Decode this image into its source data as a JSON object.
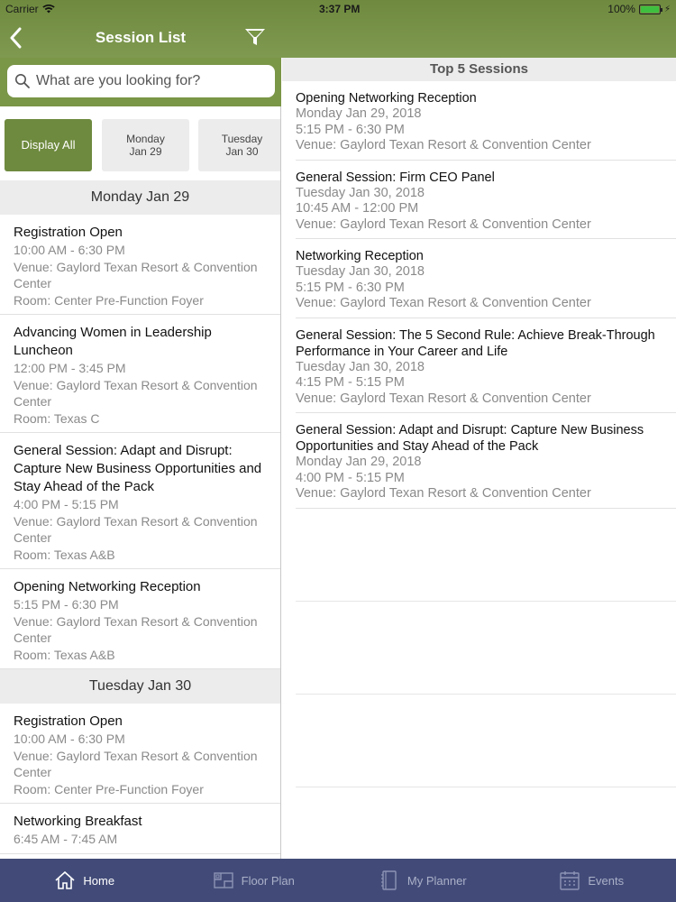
{
  "status": {
    "carrier": "Carrier",
    "time": "3:37 PM",
    "battery": "100%",
    "battery_level": 1.0
  },
  "nav": {
    "title": "Session List"
  },
  "search": {
    "placeholder": "What are you looking for?"
  },
  "filters": [
    {
      "line1": "Display All",
      "line2": ""
    },
    {
      "line1": "Monday",
      "line2": "Jan 29"
    },
    {
      "line1": "Tuesday",
      "line2": "Jan 30"
    }
  ],
  "days": [
    {
      "header": "Monday Jan 29",
      "sessions": [
        {
          "title": "Registration Open",
          "time": "10:00 AM - 6:30 PM",
          "venue": "Venue: Gaylord Texan Resort & Convention Center",
          "room": "Room: Center Pre-Function Foyer"
        },
        {
          "title": "Advancing Women in Leadership Luncheon",
          "time": "12:00 PM - 3:45 PM",
          "venue": "Venue: Gaylord Texan Resort & Convention Center",
          "room": "Room: Texas C"
        },
        {
          "title": "General Session: Adapt and Disrupt: Capture New Business Opportunities and Stay Ahead of the Pack",
          "time": "4:00 PM - 5:15 PM",
          "venue": "Venue: Gaylord Texan Resort & Convention Center",
          "room": "Room: Texas A&B"
        },
        {
          "title": "Opening Networking Reception",
          "time": "5:15 PM - 6:30 PM",
          "venue": "Venue: Gaylord Texan Resort & Convention Center",
          "room": "Room: Texas A&B"
        }
      ]
    },
    {
      "header": "Tuesday Jan 30",
      "sessions": [
        {
          "title": "Registration Open",
          "time": "10:00 AM - 6:30 PM",
          "venue": "Venue: Gaylord Texan Resort & Convention Center",
          "room": "Room: Center Pre-Function Foyer"
        },
        {
          "title": "Networking Breakfast",
          "time": "6:45 AM - 7:45 AM",
          "venue": "",
          "room": ""
        }
      ]
    }
  ],
  "top5": {
    "header": "Top 5 Sessions",
    "items": [
      {
        "title": "Opening Networking Reception",
        "date": "Monday Jan 29, 2018",
        "time": "5:15 PM - 6:30 PM",
        "venue": "Venue: Gaylord Texan Resort & Convention Center"
      },
      {
        "title": "General Session: Firm CEO Panel",
        "date": "Tuesday Jan 30, 2018",
        "time": "10:45 AM - 12:00 PM",
        "venue": "Venue: Gaylord Texan Resort & Convention Center"
      },
      {
        "title": "Networking Reception",
        "date": "Tuesday Jan 30, 2018",
        "time": "5:15 PM - 6:30 PM",
        "venue": "Venue: Gaylord Texan Resort & Convention Center"
      },
      {
        "title": "General Session: The 5 Second Rule: Achieve Break-Through Performance in Your Career and Life",
        "date": "Tuesday Jan 30, 2018",
        "time": "4:15 PM - 5:15 PM",
        "venue": "Venue: Gaylord Texan Resort & Convention Center"
      },
      {
        "title": "General Session: Adapt and Disrupt: Capture New Business Opportunities and Stay Ahead of the Pack",
        "date": "Monday Jan 29, 2018",
        "time": "4:00 PM - 5:15 PM",
        "venue": "Venue: Gaylord Texan Resort & Convention Center"
      }
    ]
  },
  "tabs": [
    {
      "label": "Home",
      "icon": "home-icon"
    },
    {
      "label": "Floor Plan",
      "icon": "floor-plan-icon"
    },
    {
      "label": "My Planner",
      "icon": "planner-icon"
    },
    {
      "label": "Events",
      "icon": "calendar-icon"
    }
  ],
  "colors": {
    "brand_green": "#7a9647",
    "tabbar": "#424b78"
  }
}
